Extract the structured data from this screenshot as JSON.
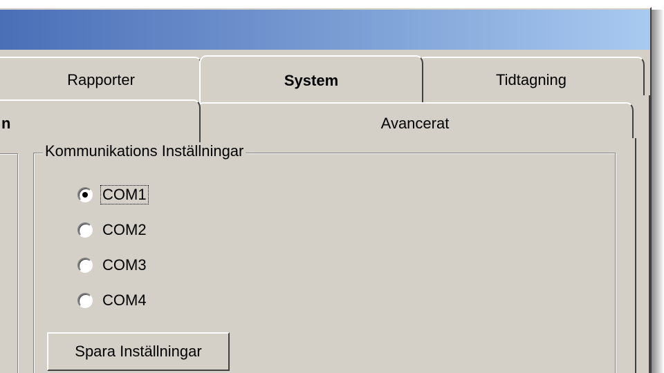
{
  "tabs_top": [
    {
      "label": "Rapporter",
      "selected": false
    },
    {
      "label": "System",
      "selected": true
    },
    {
      "label": "Tidtagning",
      "selected": false
    }
  ],
  "tabs_sub": [
    {
      "label": "n",
      "selected": true
    },
    {
      "label": "Avancerat",
      "selected": false
    }
  ],
  "group": {
    "title": "Kommunikations Inställningar",
    "ports": [
      {
        "label": "COM1",
        "checked": true
      },
      {
        "label": "COM2",
        "checked": false
      },
      {
        "label": "COM3",
        "checked": false
      },
      {
        "label": "COM4",
        "checked": false
      }
    ],
    "save_button": "Spara Inställningar"
  },
  "colors": {
    "face": "#d4d0c8",
    "titlebar_start": "#4a6fb7",
    "titlebar_end": "#a9caf0"
  }
}
